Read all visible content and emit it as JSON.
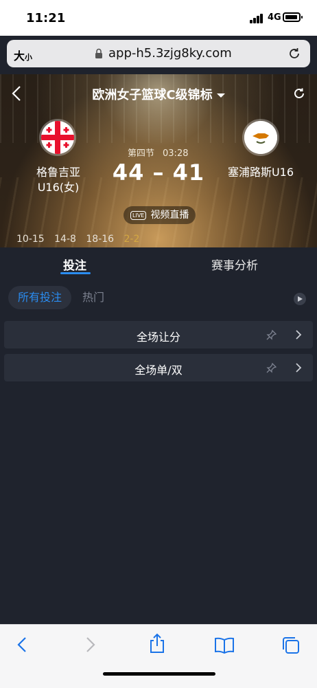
{
  "status": {
    "time": "11:21",
    "network": "4G"
  },
  "browser": {
    "text_size_big": "大",
    "text_size_small": "小",
    "url": "app-h5.3zjg8ky.com"
  },
  "match": {
    "league": "欧洲女子篮球C级锦标",
    "home_team": [
      "格鲁吉亚",
      "U16(女)"
    ],
    "away_team": "塞浦路斯U16",
    "period": "第四节",
    "clock": "03:28",
    "score": "44 – 41",
    "live_badge": "LIVE",
    "live_label": "视频直播",
    "quarters": [
      "10-15",
      "14-8",
      "18-16"
    ],
    "current_quarter": "2-2"
  },
  "tabs": {
    "bet": "投注",
    "analysis": "赛事分析"
  },
  "filters": {
    "all": "所有投注",
    "hot": "热门"
  },
  "markets": [
    "全场让分",
    "全场单/双"
  ],
  "colors": {
    "accent": "#2a8cf0",
    "background": "#1f232d",
    "card": "#2a2f3a",
    "current_quarter": "#d4a843"
  }
}
